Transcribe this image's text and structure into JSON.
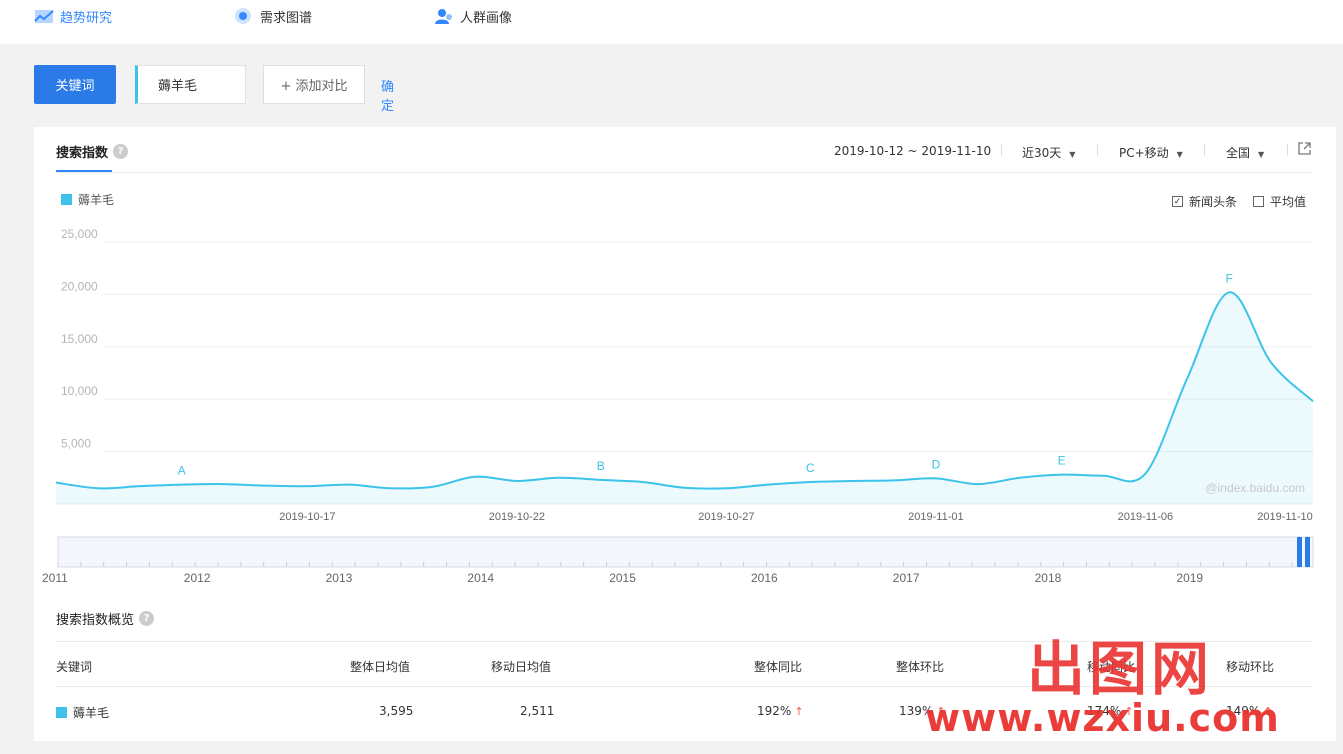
{
  "nav": {
    "items": [
      {
        "label": "趋势研究",
        "icon": "trend-chart-icon"
      },
      {
        "label": "需求图谱",
        "icon": "radar-icon"
      },
      {
        "label": "人群画像",
        "icon": "user-icon"
      }
    ]
  },
  "keyword_bar": {
    "keyword_button": "关键词",
    "keyword_value": "薅羊毛",
    "add_compare": "+ 添加对比",
    "confirm": "确定"
  },
  "search_index": {
    "tab_label": "搜索指数",
    "date_range": "2019-10-12 ~ 2019-11-10",
    "period": "近30天",
    "device": "PC+移动",
    "region": "全国",
    "options": {
      "news": "新闻头条",
      "average": "平均值"
    },
    "news_checked": true,
    "average_checked": false,
    "watermark": "@index.baidu.com"
  },
  "overview": {
    "title": "搜索指数概览",
    "headers": [
      "关键词",
      "整体日均值",
      "移动日均值",
      "整体同比",
      "整体环比",
      "移动同比",
      "移动环比"
    ],
    "row": {
      "keyword": "薅羊毛",
      "overall_avg": "3,595",
      "mobile_avg": "2,511",
      "overall_yoy": "192%",
      "overall_mom": "139%",
      "mobile_yoy": "174%",
      "mobile_mom": "149%"
    }
  },
  "watermark": {
    "text1": "出图网",
    "text2": "www.wzxiu.com"
  },
  "colors": {
    "accent": "#3388ff",
    "series": "#3bc3e9",
    "button": "#2a7be8",
    "up_arrow": "#f15a3b"
  },
  "chart_data": {
    "type": "area",
    "title": "",
    "series": [
      {
        "name": "薅羊毛",
        "values": [
          2050,
          1500,
          1700,
          1850,
          1900,
          1750,
          1700,
          1850,
          1500,
          1650,
          2600,
          2200,
          2500,
          2300,
          2100,
          1550,
          1500,
          1850,
          2100,
          2200,
          2250,
          2450,
          1900,
          2500,
          2800,
          2700,
          2900,
          12000,
          20200,
          13500,
          9800
        ]
      }
    ],
    "x": [
      "2019-10-11",
      "2019-10-12",
      "2019-10-13",
      "2019-10-14",
      "2019-10-15",
      "2019-10-16",
      "2019-10-17",
      "2019-10-18",
      "2019-10-19",
      "2019-10-20",
      "2019-10-21",
      "2019-10-22",
      "2019-10-23",
      "2019-10-24",
      "2019-10-25",
      "2019-10-26",
      "2019-10-27",
      "2019-10-28",
      "2019-10-29",
      "2019-10-30",
      "2019-10-31",
      "2019-11-01",
      "2019-11-02",
      "2019-11-03",
      "2019-11-04",
      "2019-11-05",
      "2019-11-06",
      "2019-11-07",
      "2019-11-08",
      "2019-11-09",
      "2019-11-10"
    ],
    "x_ticks": [
      "2019-10-17",
      "2019-10-22",
      "2019-10-27",
      "2019-11-01",
      "2019-11-06",
      "2019-11-10"
    ],
    "y_ticks": [
      "5,000",
      "10,000",
      "15,000",
      "20,000",
      "25,000"
    ],
    "ylim": [
      0,
      25000
    ],
    "annotations": [
      {
        "label": "A",
        "date": "2019-10-14"
      },
      {
        "label": "B",
        "date": "2019-10-24"
      },
      {
        "label": "C",
        "date": "2019-10-29"
      },
      {
        "label": "D",
        "date": "2019-11-01"
      },
      {
        "label": "E",
        "date": "2019-11-04"
      },
      {
        "label": "F",
        "date": "2019-11-08"
      }
    ],
    "grid": true,
    "legend": "top-left",
    "timeline_years": [
      "2011",
      "2012",
      "2013",
      "2014",
      "2015",
      "2016",
      "2017",
      "2018",
      "2019"
    ]
  }
}
